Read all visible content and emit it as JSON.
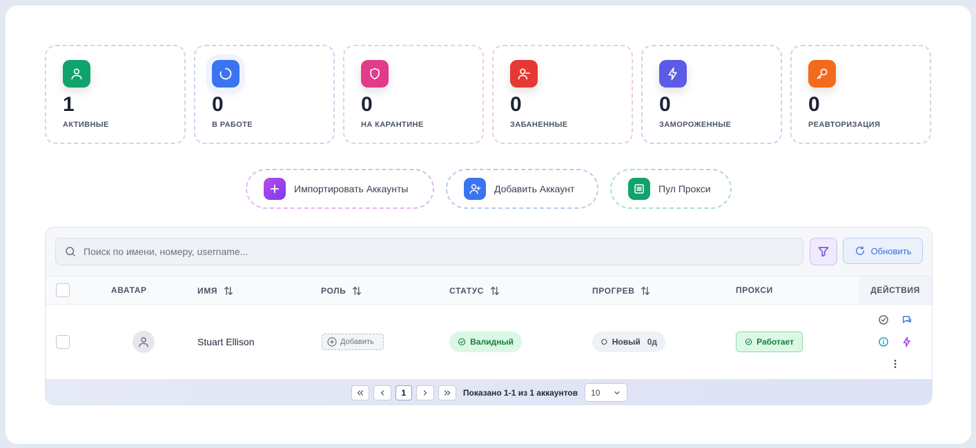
{
  "stats": [
    {
      "value": "1",
      "label": "АКТИВНЫЕ",
      "color": "#10a36b"
    },
    {
      "value": "0",
      "label": "В РАБОТЕ",
      "color": "#3b74f0"
    },
    {
      "value": "0",
      "label": "НА КАРАНТИНЕ",
      "color": "#e13b8a"
    },
    {
      "value": "0",
      "label": "ЗАБАНЕННЫЕ",
      "color": "#e53935"
    },
    {
      "value": "0",
      "label": "ЗАМОРОЖЕННЫЕ",
      "color": "#5b5be8"
    },
    {
      "value": "0",
      "label": "РЕАВТОРИЗАЦИЯ",
      "color": "#f26a1b"
    }
  ],
  "actions": {
    "import_label": "Импортировать Аккаунты",
    "add_label": "Добавить Аккаунт",
    "pool_label": "Пул Прокси"
  },
  "toolbar": {
    "search_placeholder": "Поиск по имени, номеру, username...",
    "refresh_label": "Обновить"
  },
  "columns": {
    "avatar": "АВАТАР",
    "name": "ИМЯ",
    "role": "РОЛЬ",
    "status": "СТАТУС",
    "warmup": "ПРОГРЕВ",
    "proxy": "ПРОКСИ",
    "actions": "ДЕЙСТВИЯ"
  },
  "rows": [
    {
      "name": "Stuart Ellison",
      "role_add_label": "Добавить",
      "status": "Валидный",
      "warmup": "Новый",
      "warmup_days": "0д",
      "proxy": "Работает"
    }
  ],
  "pagination": {
    "current_page": "1",
    "info": "Показано 1-1 из 1 аккаунтов",
    "page_size": "10"
  },
  "colors": {
    "accent_blue": "#3b6fd6",
    "success_green": "#15803d",
    "filter_purple": "#7c4ddb"
  }
}
